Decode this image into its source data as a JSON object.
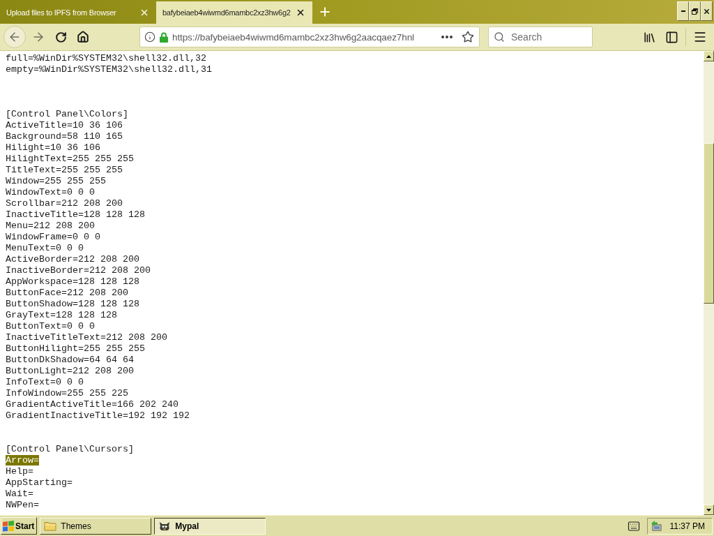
{
  "browser": {
    "tabs": [
      {
        "title": "Upload files to IPFS from Browser",
        "selected": false
      },
      {
        "title": "bafybeiaeb4wiwmd6mambc2xz3hw6g2",
        "selected": true
      }
    ],
    "address_bar": {
      "url": "https://bafybeiaeb4wiwmd6mambc2xz3hw6g2aacqaez7hnl"
    },
    "search": {
      "placeholder": "Search"
    }
  },
  "document": {
    "lines": [
      {
        "kind": "text",
        "text": "full=%WinDir%SYSTEM32\\shell32.dll,32",
        "highlighted": false
      },
      {
        "kind": "text",
        "text": "empty=%WinDir%SYSTEM32\\shell32.dll,31",
        "highlighted": false
      },
      {
        "kind": "blank"
      },
      {
        "kind": "blank"
      },
      {
        "kind": "blank"
      },
      {
        "kind": "text",
        "text": "[Control Panel\\Colors]",
        "highlighted": false
      },
      {
        "kind": "text",
        "text": "ActiveTitle=10 36 106",
        "highlighted": false
      },
      {
        "kind": "text",
        "text": "Background=58 110 165",
        "highlighted": false
      },
      {
        "kind": "text",
        "text": "Hilight=10 36 106",
        "highlighted": false
      },
      {
        "kind": "text",
        "text": "HilightText=255 255 255",
        "highlighted": false
      },
      {
        "kind": "text",
        "text": "TitleText=255 255 255",
        "highlighted": false
      },
      {
        "kind": "text",
        "text": "Window=255 255 255",
        "highlighted": false
      },
      {
        "kind": "text",
        "text": "WindowText=0 0 0",
        "highlighted": false
      },
      {
        "kind": "text",
        "text": "Scrollbar=212 208 200",
        "highlighted": false
      },
      {
        "kind": "text",
        "text": "InactiveTitle=128 128 128",
        "highlighted": false
      },
      {
        "kind": "text",
        "text": "Menu=212 208 200",
        "highlighted": false
      },
      {
        "kind": "text",
        "text": "WindowFrame=0 0 0",
        "highlighted": false
      },
      {
        "kind": "text",
        "text": "MenuText=0 0 0",
        "highlighted": false
      },
      {
        "kind": "text",
        "text": "ActiveBorder=212 208 200",
        "highlighted": false
      },
      {
        "kind": "text",
        "text": "InactiveBorder=212 208 200",
        "highlighted": false
      },
      {
        "kind": "text",
        "text": "AppWorkspace=128 128 128",
        "highlighted": false
      },
      {
        "kind": "text",
        "text": "ButtonFace=212 208 200",
        "highlighted": false
      },
      {
        "kind": "text",
        "text": "ButtonShadow=128 128 128",
        "highlighted": false
      },
      {
        "kind": "text",
        "text": "GrayText=128 128 128",
        "highlighted": false
      },
      {
        "kind": "text",
        "text": "ButtonText=0 0 0",
        "highlighted": false
      },
      {
        "kind": "text",
        "text": "InactiveTitleText=212 208 200",
        "highlighted": false
      },
      {
        "kind": "text",
        "text": "ButtonHilight=255 255 255",
        "highlighted": false
      },
      {
        "kind": "text",
        "text": "ButtonDkShadow=64 64 64",
        "highlighted": false
      },
      {
        "kind": "text",
        "text": "ButtonLight=212 208 200",
        "highlighted": false
      },
      {
        "kind": "text",
        "text": "InfoText=0 0 0",
        "highlighted": false
      },
      {
        "kind": "text",
        "text": "InfoWindow=255 255 225",
        "highlighted": false
      },
      {
        "kind": "text",
        "text": "GradientActiveTitle=166 202 240",
        "highlighted": false
      },
      {
        "kind": "text",
        "text": "GradientInactiveTitle=192 192 192",
        "highlighted": false
      },
      {
        "kind": "blank"
      },
      {
        "kind": "blank"
      },
      {
        "kind": "text",
        "text": "[Control Panel\\Cursors]",
        "highlighted": false
      },
      {
        "kind": "text",
        "text": "Arrow=",
        "highlighted": true
      },
      {
        "kind": "text",
        "text": "Help=",
        "highlighted": false
      },
      {
        "kind": "text",
        "text": "AppStarting=",
        "highlighted": false
      },
      {
        "kind": "text",
        "text": "Wait=",
        "highlighted": false
      },
      {
        "kind": "text",
        "text": "NWPen=",
        "highlighted": false
      }
    ]
  },
  "taskbar": {
    "start": "Start",
    "windows": [
      {
        "label": "Themes",
        "selected": false
      },
      {
        "label": "Mypal",
        "selected": true
      }
    ],
    "clock": "11:37 PM"
  }
}
